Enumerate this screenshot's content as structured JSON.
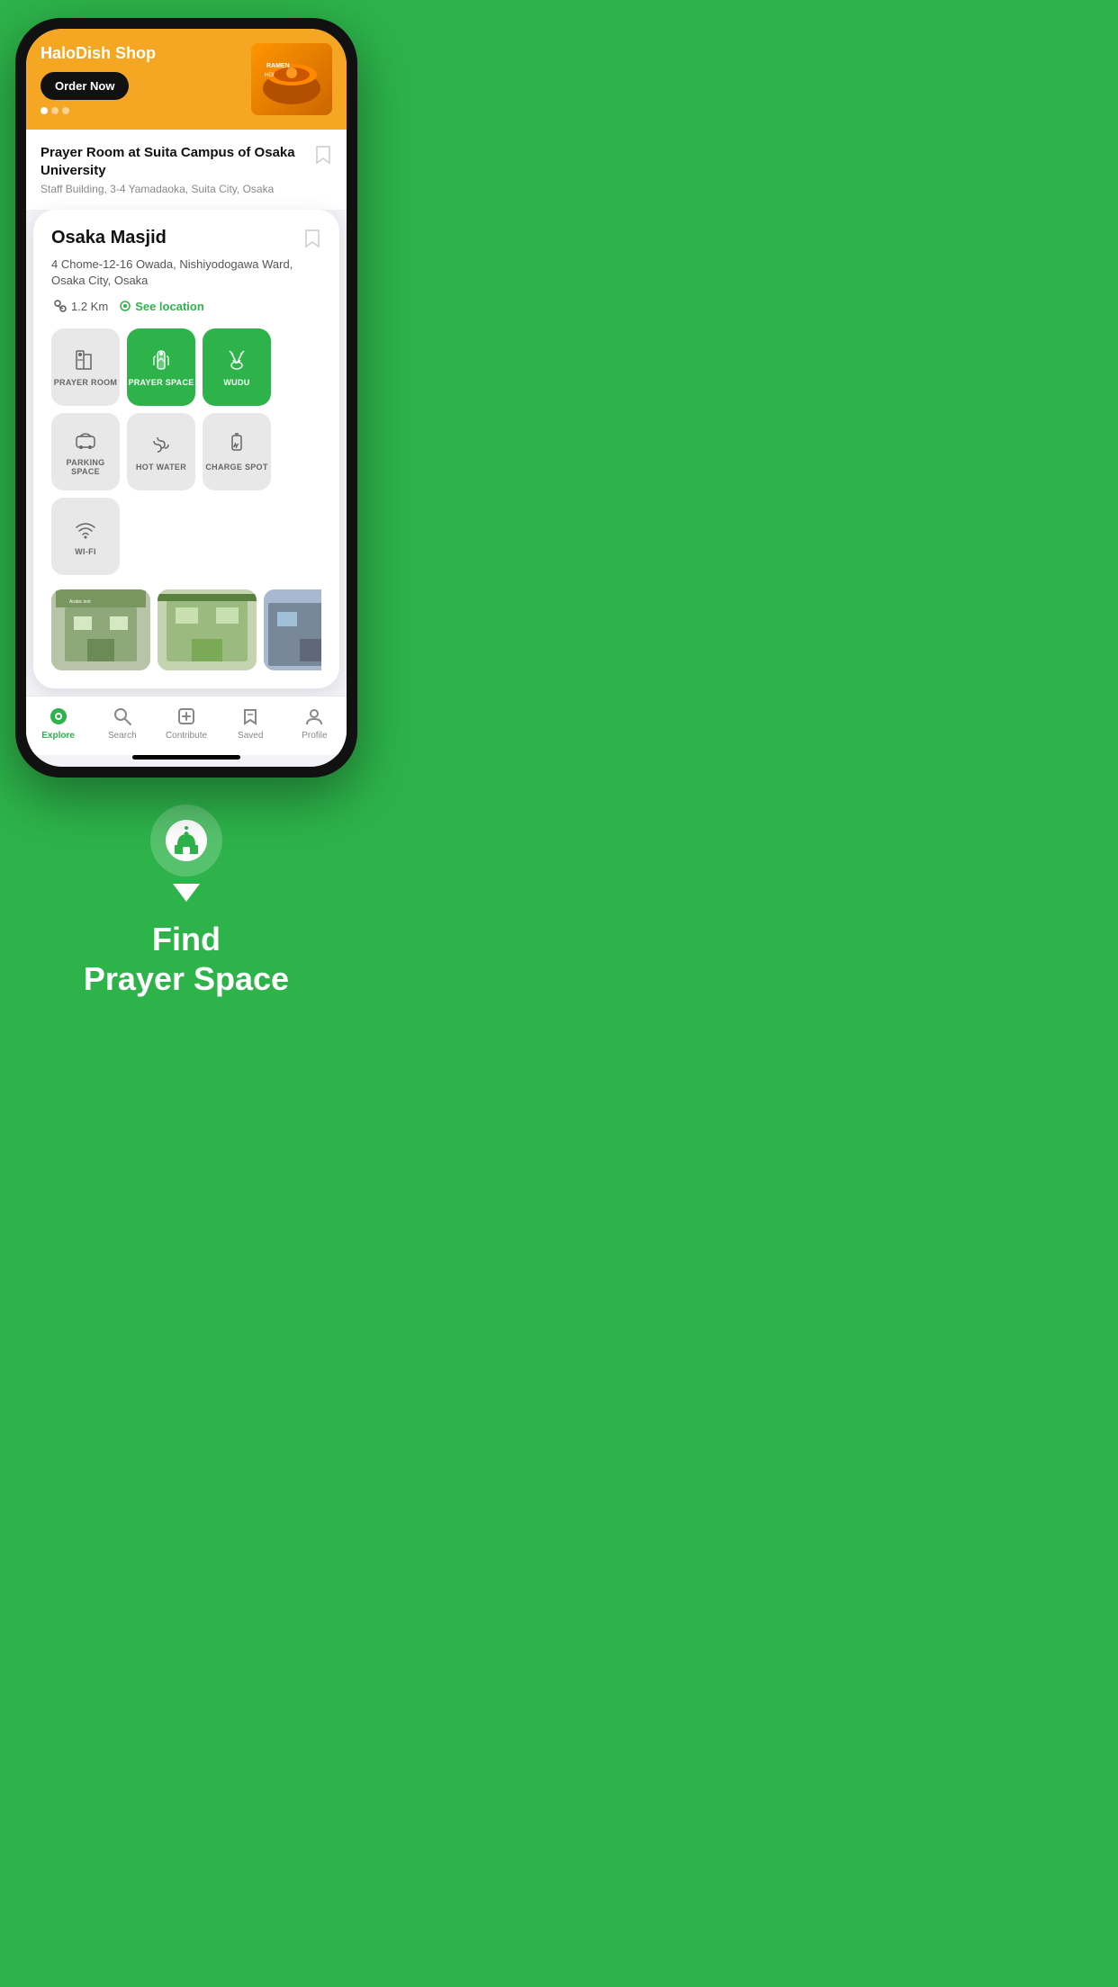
{
  "background_color": "#2db34a",
  "phone": {
    "top_banner": {
      "shop_name": "HaloDish Shop",
      "order_button": "Order Now",
      "dots": [
        true,
        false,
        false
      ]
    },
    "prayer_mini": {
      "title": "Prayer Room at Suita Campus of Osaka University",
      "address": "Staff Building, 3-4 Yamadaoka, Suita City, Osaka"
    },
    "main_card": {
      "name": "Osaka Masjid",
      "address": "4 Chome-12-16 Owada, Nishiyodogawa Ward, Osaka City, Osaka",
      "distance": "1.2 Km",
      "see_location": "See location",
      "amenities": [
        {
          "label": "PRAYER\nROOM",
          "active": false,
          "icon": "prayer-room"
        },
        {
          "label": "PRAYER\nSPACE",
          "active": true,
          "icon": "prayer-space"
        },
        {
          "label": "WUDU",
          "active": true,
          "icon": "wudu"
        },
        {
          "label": "PARKING\nSPACE",
          "active": false,
          "icon": "parking"
        },
        {
          "label": "HOT\nWATER",
          "active": false,
          "icon": "hot-water"
        },
        {
          "label": "CHARGE\nSPOT",
          "active": false,
          "icon": "charge-spot"
        },
        {
          "label": "WI-FI",
          "active": false,
          "icon": "wifi"
        }
      ],
      "photos": [
        "photo1",
        "photo2",
        "photo3",
        "photo4",
        "photo5"
      ]
    },
    "bottom_nav": [
      {
        "label": "Explore",
        "icon": "explore",
        "active": true
      },
      {
        "label": "Search",
        "icon": "search",
        "active": false
      },
      {
        "label": "Contribute",
        "icon": "contribute",
        "active": false
      },
      {
        "label": "Saved",
        "icon": "saved",
        "active": false
      },
      {
        "label": "Profile",
        "icon": "profile",
        "active": false
      }
    ]
  },
  "branding": {
    "find_text": "Find",
    "prayer_text": "Prayer Space"
  }
}
